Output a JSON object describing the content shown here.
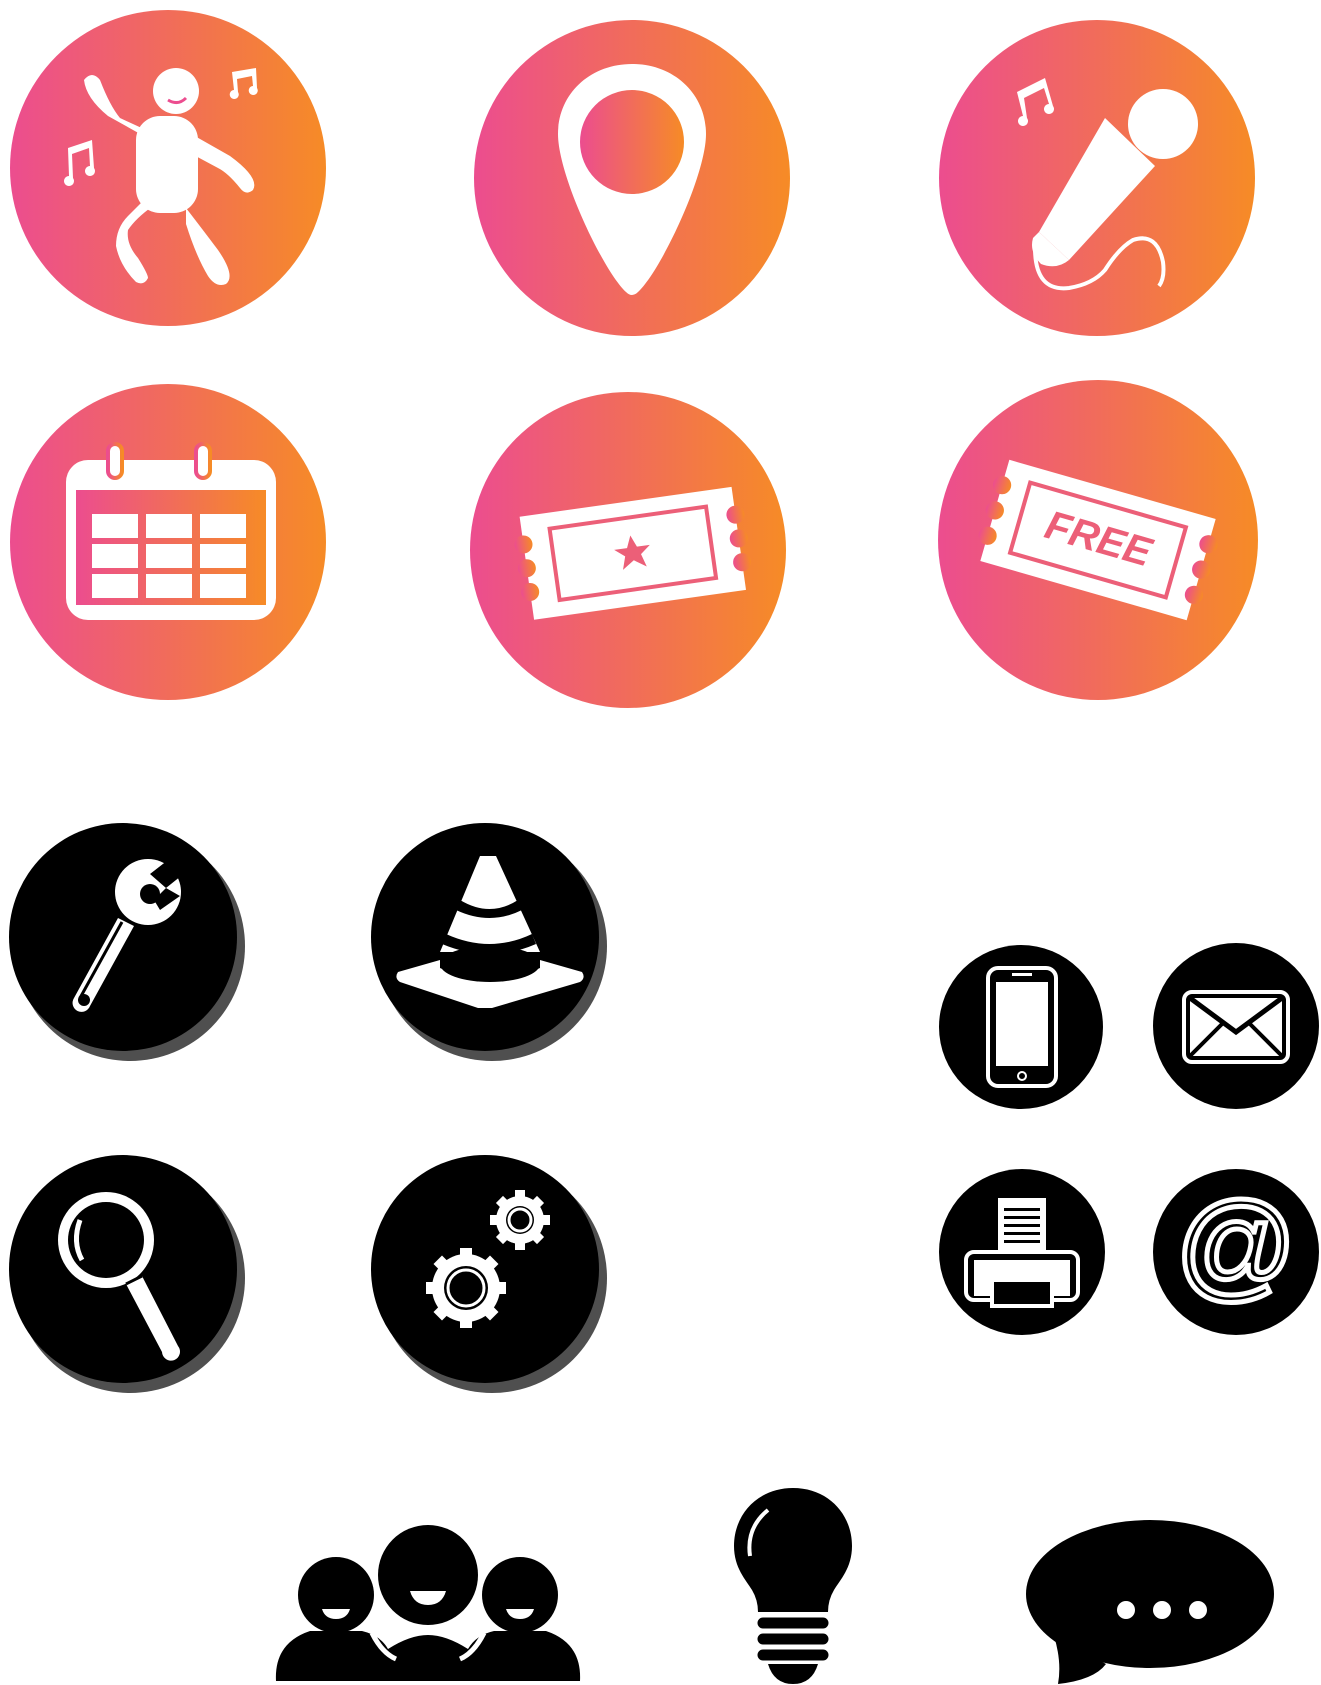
{
  "colors": {
    "gradient_start": "#ec4d8f",
    "gradient_end": "#f68b26",
    "dark": "#000000",
    "shadow": "#4f4f4f",
    "light": "#ffffff"
  },
  "icons": {
    "dancing": "dancing-person-icon",
    "location": "location-pin-icon",
    "karaoke": "microphone-icon",
    "calendar": "calendar-icon",
    "ticket": "ticket-icon",
    "free_ticket": "free-ticket-icon",
    "wrench": "wrench-icon",
    "cone": "traffic-cone-icon",
    "search": "magnifier-icon",
    "gears": "gears-icon",
    "phone": "smartphone-icon",
    "mail": "envelope-icon",
    "fax": "fax-printer-icon",
    "at": "at-sign-icon",
    "group": "people-group-icon",
    "idea": "light-bulb-icon",
    "chat": "speech-bubble-icon"
  },
  "ticket_free": {
    "label": "FREE"
  },
  "at_sign": {
    "glyph": "@"
  }
}
